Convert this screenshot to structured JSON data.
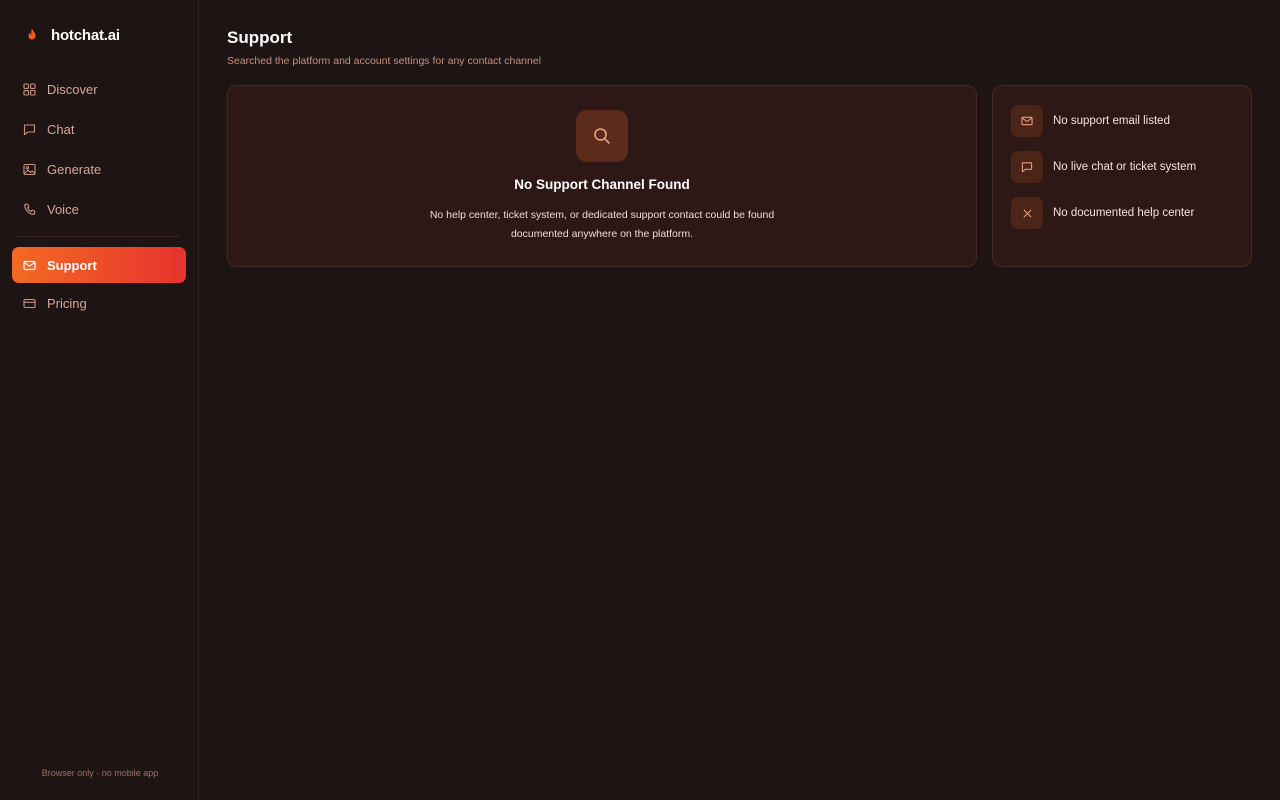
{
  "brand": {
    "name": "hotchat.ai",
    "icon": "flame-icon",
    "color": "#f05a23"
  },
  "sidebar": {
    "items": [
      {
        "label": "Discover",
        "icon": "grid-icon"
      },
      {
        "label": "Chat",
        "icon": "chat-bubble-icon"
      },
      {
        "label": "Generate",
        "icon": "image-icon"
      },
      {
        "label": "Voice",
        "icon": "phone-icon"
      }
    ],
    "items2": [
      {
        "label": "Support",
        "icon": "mail-icon",
        "active": true
      },
      {
        "label": "Pricing",
        "icon": "credit-card-icon"
      }
    ],
    "footer": "Browser only · no mobile app"
  },
  "page": {
    "title": "Support",
    "subtitle": "Searched the platform and account settings for any contact channel"
  },
  "empty_state": {
    "icon": "search-icon",
    "title": "No Support Channel Found",
    "description": "No help center, ticket system, or dedicated support contact could be found documented anywhere on the platform."
  },
  "checklist": [
    {
      "icon": "mail-icon",
      "label": "No support email listed"
    },
    {
      "icon": "chat-bubble-icon",
      "label": "No live chat or ticket system"
    },
    {
      "icon": "close-icon",
      "label": "No documented help center"
    }
  ],
  "colors": {
    "background": "#1f1414",
    "card": "#2d1816",
    "accent_start": "#f36a22",
    "accent_end": "#e6332e"
  }
}
